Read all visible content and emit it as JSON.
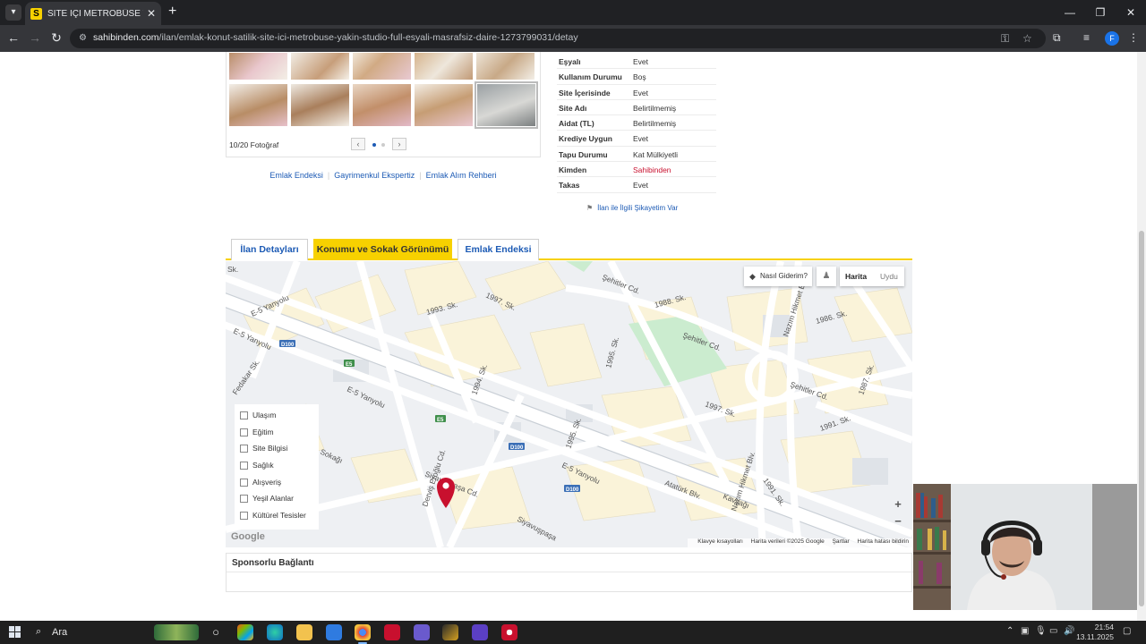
{
  "browser": {
    "tab_title": "SİTE İÇİ METROBÜSE YAKIN STÜDYO",
    "tab_favicon": "S",
    "url_domain": "sahibinden.com",
    "url_path": "/ilan/emlak-konut-satilik-site-ici-metrobuse-yakin-studio-full-esyali-masrafsiz-daire-1273799031/detay",
    "profile_initial": "F"
  },
  "gallery": {
    "photo_count": "10/20 Fotoğraf"
  },
  "quick_links": [
    "Emlak Endeksi",
    "Gayrimenkul Ekspertiz",
    "Emlak Alım Rehberi"
  ],
  "properties": [
    {
      "key": "Eşyalı",
      "value": "Evet"
    },
    {
      "key": "Kullanım Durumu",
      "value": "Boş"
    },
    {
      "key": "Site İçerisinde",
      "value": "Evet"
    },
    {
      "key": "Site Adı",
      "value": "Belirtilmemiş"
    },
    {
      "key": "Aidat (TL)",
      "value": "Belirtilmemiş"
    },
    {
      "key": "Krediye Uygun",
      "value": "Evet"
    },
    {
      "key": "Tapu Durumu",
      "value": "Kat Mülkiyetli"
    },
    {
      "key": "Kimden",
      "value": "Sahibinden"
    },
    {
      "key": "Takas",
      "value": "Evet"
    }
  ],
  "complaint_link": "İlan ile İlgili Şikayetim Var",
  "detail_tabs": [
    "İlan Detayları",
    "Konumu ve Sokak Görünümü",
    "Emlak Endeksi"
  ],
  "map": {
    "directions_label": "Nasıl Giderim?",
    "map_type_active": "Harita",
    "map_type_other": "Uydu",
    "filters": [
      "Ulaşım",
      "Eğitim",
      "Site Bilgisi",
      "Sağlık",
      "Alışveriş",
      "Yeşil Alanlar",
      "Kültürel Tesisler"
    ],
    "google_logo": "Google",
    "attribution": [
      "Klavye kısayolları",
      "Harita verileri ©2025 Google",
      "Şartlar",
      "Harita hatası bildirin"
    ],
    "labels": {
      "sk_top": "Sk.",
      "sk_1993": "1993. Sk.",
      "sk_1997_top": "1997. Sk.",
      "sehitler_cd_top": "Şehitler Cd.",
      "sk_1988": "1988. Sk.",
      "nazim_hikmet_top": "Nazım Hikmet Blv.",
      "sk_1986": "1986. Sk.",
      "e5_a": "E-5 Yanyolu",
      "e5_b": "E-5 Yanyolu",
      "d100_a": "D100",
      "e5_badge_a": "E5",
      "fedakar_sk": "Fedakar Sk.",
      "sk_1995": "1995. Sk.",
      "sehitler_cd_mid": "Şehitler Cd.",
      "sk_1994": "1994. Sk.",
      "e5_c": "E-5 Yanyolu",
      "sehitler_cd_right": "Şehitler Cd.",
      "sk_1987": "1987. Sk.",
      "sk_1997_mid": "1997. Sk.",
      "sk_1995_b": "1995. Sk.",
      "e5_badge_b": "E5",
      "d100_b": "D100",
      "sk_1991_a": "1991. Sk.",
      "sokagi": "Sokağı",
      "dervis_eroglu": "Derviş Eroğlu Cd.",
      "e5_d": "E-5 Yanyolu",
      "nazim_hikmet_bottom": "Nazım Hikmet Blv.",
      "siyavupasa_a": "Siyavuşpaşa Cd.",
      "d100_c": "D100",
      "ataturk_blv": "Atatürk Blv.",
      "kavsagi": "Kavşağı",
      "sk_1991_b": "1991. Sk.",
      "siyavupasa_b": "Siyavuşpaşa"
    }
  },
  "sponsor_title": "Sponsorlu Bağlantı",
  "taskbar": {
    "search_placeholder": "Ara",
    "time": "21:54",
    "date": "13.11.2025"
  }
}
